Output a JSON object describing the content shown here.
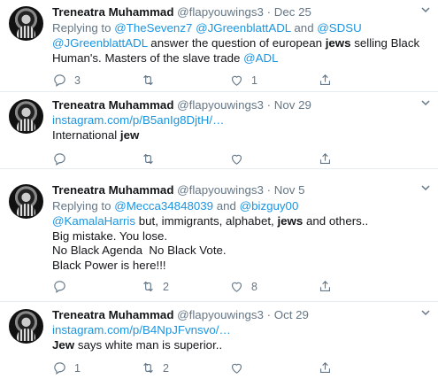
{
  "tweets": [
    {
      "name": "Treneatra Muhammad",
      "handle": "@flapyouwings3",
      "sep": "·",
      "date": "Dec 25",
      "reply_prefix": "Replying to ",
      "reply_1": "@TheSevenz7",
      "reply_2": "@JGreenblattADL",
      "reply_and": " and ",
      "reply_3": "@SDSU",
      "body_mention": "@JGreenblattADL",
      "body_t1": " answer the question of european ",
      "body_bold": "jews",
      "body_t2": " selling Black",
      "body_t3": "Human's. Masters of the slave trade ",
      "body_mention2": "@ADL",
      "replies": "3",
      "retweets": "",
      "likes": "1"
    },
    {
      "name": "Treneatra Muhammad",
      "handle": "@flapyouwings3",
      "sep": "·",
      "date": "Nov 29",
      "link": "instagram.com/p/B5anIg8DjtH/…",
      "body_t1": "International ",
      "body_bold": "jew",
      "replies": "",
      "retweets": "",
      "likes": ""
    },
    {
      "name": "Treneatra Muhammad",
      "handle": "@flapyouwings3",
      "sep": "·",
      "date": "Nov 5",
      "reply_prefix": "Replying to ",
      "reply_1": "@Mecca34848039",
      "reply_and": " and ",
      "reply_2": "@bizguy00",
      "body_mention": "@KamalaHarris",
      "body_t1": " but, immigrants, alphabet, ",
      "body_bold": "jews",
      "body_t2": " and others..",
      "line2": "Big mistake. You lose.",
      "line3": "No Black Agenda  No Black Vote.",
      "line4": "Black Power is here!!!",
      "replies": "",
      "retweets": "2",
      "likes": "8"
    },
    {
      "name": "Treneatra Muhammad",
      "handle": "@flapyouwings3",
      "sep": "·",
      "date": "Oct 29",
      "link": "instagram.com/p/B4NpJFvnsvo/…",
      "body_bold": "Jew",
      "body_t1": " says white man is superior..",
      "replies": "1",
      "retweets": "2",
      "likes": ""
    }
  ]
}
